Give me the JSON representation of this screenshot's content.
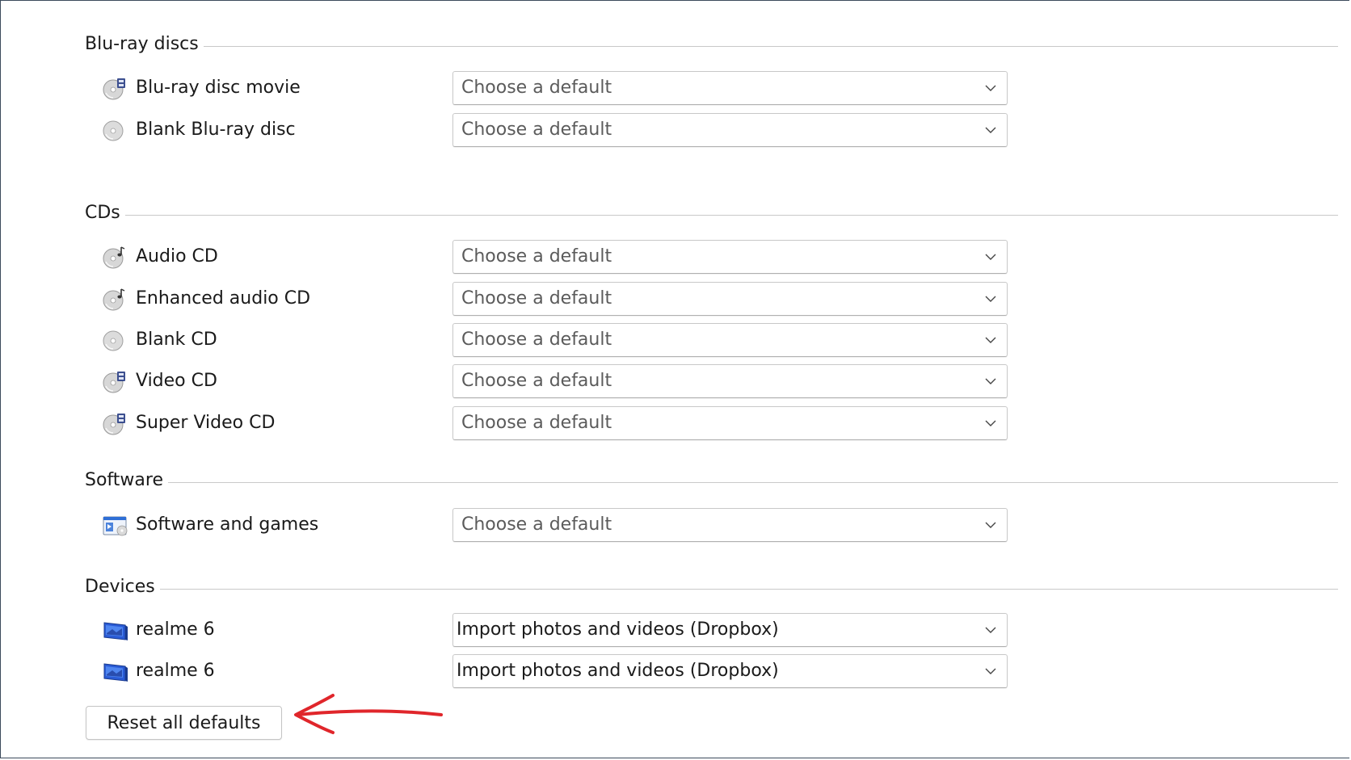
{
  "sections": [
    {
      "title": "Blu-ray discs",
      "items": [
        {
          "label": "Blu-ray disc movie",
          "icon": "video-disc-icon",
          "value": "Choose a default"
        },
        {
          "label": "Blank Blu-ray disc",
          "icon": "blank-disc-icon",
          "value": "Choose a default"
        }
      ]
    },
    {
      "title": "CDs",
      "items": [
        {
          "label": "Audio CD",
          "icon": "audio-disc-icon",
          "value": "Choose a default"
        },
        {
          "label": "Enhanced audio CD",
          "icon": "audio-disc-icon",
          "value": "Choose a default"
        },
        {
          "label": "Blank CD",
          "icon": "blank-disc-icon",
          "value": "Choose a default"
        },
        {
          "label": "Video CD",
          "icon": "video-disc-icon",
          "value": "Choose a default"
        },
        {
          "label": "Super Video CD",
          "icon": "video-disc-icon",
          "value": "Choose a default"
        }
      ]
    },
    {
      "title": "Software",
      "items": [
        {
          "label": "Software and games",
          "icon": "software-window-icon",
          "value": "Choose a default"
        }
      ]
    },
    {
      "title": "Devices",
      "items": [
        {
          "label": "realme 6",
          "icon": "device-icon",
          "value": "Import photos and videos (Dropbox)"
        },
        {
          "label": "realme 6",
          "icon": "device-icon",
          "value": "Import photos and videos (Dropbox)"
        }
      ]
    }
  ],
  "reset_button": {
    "label": "Reset all defaults"
  },
  "colors": {
    "annotation_arrow": "#e0262b",
    "device_icon_blue": "#2a5bd6"
  }
}
